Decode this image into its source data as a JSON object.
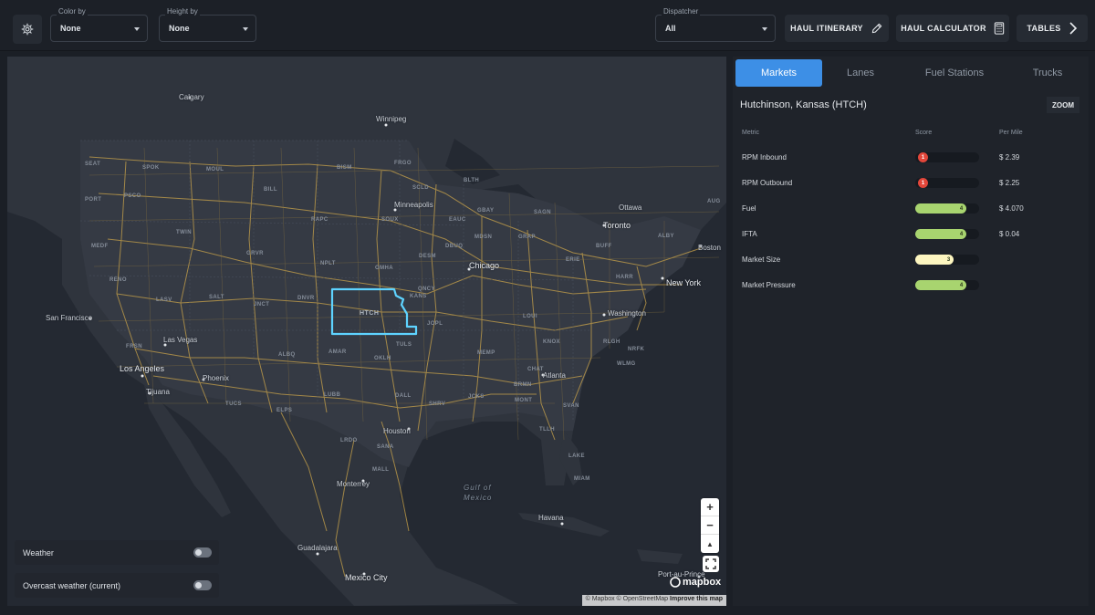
{
  "toolbar": {
    "color_by": {
      "label": "Color by",
      "value": "None"
    },
    "height_by": {
      "label": "Height by",
      "value": "None"
    },
    "dispatcher": {
      "label": "Dispatcher",
      "value": "All"
    },
    "haul_itinerary": "HAUL ITINERARY",
    "haul_calculator": "HAUL CALCULATOR",
    "tables": "TABLES"
  },
  "map": {
    "selected_market": "HTCH",
    "places": [
      {
        "name": "Calgary"
      },
      {
        "name": "Winnipeg"
      },
      {
        "name": "Minneapolis"
      },
      {
        "name": "Ottawa"
      },
      {
        "name": "Toronto"
      },
      {
        "name": "Boston"
      },
      {
        "name": "Chicago"
      },
      {
        "name": "New York"
      },
      {
        "name": "Washington"
      },
      {
        "name": "San Francisco"
      },
      {
        "name": "Las Vegas"
      },
      {
        "name": "Los Angeles"
      },
      {
        "name": "Phoenix"
      },
      {
        "name": "Tijuana"
      },
      {
        "name": "Houston"
      },
      {
        "name": "Atlanta"
      },
      {
        "name": "Monterrey"
      },
      {
        "name": "Havana"
      },
      {
        "name": "Guadalajara"
      },
      {
        "name": "Mexico City"
      },
      {
        "name": "Port-au-Prince"
      }
    ],
    "gulf_label_1": "Gulf of",
    "gulf_label_2": "Mexico",
    "market_codes": [
      "SEAT",
      "SPOK",
      "MOUL",
      "BISM",
      "FRGO",
      "BILL",
      "SCLD",
      "BLTH",
      "PORT",
      "PSCO",
      "RAPC",
      "SOUX",
      "EAUC",
      "GBAY",
      "SAGN",
      "AUG",
      "MEDF",
      "TWIN",
      "GRVR",
      "NPLT",
      "OMHA",
      "DBUQ",
      "DESM",
      "MDSN",
      "GRAP",
      "BUFF",
      "ALBY",
      "RENO",
      "SALT",
      "LASV",
      "JNCT",
      "DNVR",
      "KANS",
      "QNCY",
      "JOPL",
      "ERIE",
      "HARR",
      "NRFK",
      "FRSN",
      "AMAR",
      "OKLH",
      "TULS",
      "DALL",
      "LUBB",
      "SHRV",
      "MONT",
      "JCKS",
      "SVAN",
      "ELPS",
      "LRDO",
      "SANA",
      "MALL",
      "TLLH",
      "LAKE",
      "MIAM",
      "ALBQ",
      "TUCS",
      "MEMP",
      "BRMN",
      "CHAT",
      "KNOX",
      "RLGH",
      "WLMG",
      "LOUI"
    ],
    "zoom_in": "+",
    "zoom_out": "−",
    "compass": "▲",
    "logo_text": "mapbox",
    "attribution_1": "© Mapbox © OpenStreetMap",
    "attribution_2": "Improve this map",
    "weather_label": "Weather",
    "overcast_label": "Overcast weather (current)"
  },
  "panel": {
    "tabs": [
      {
        "label": "Markets",
        "active": true
      },
      {
        "label": "Lanes",
        "active": false
      },
      {
        "label": "Fuel Stations",
        "active": false
      },
      {
        "label": "Trucks",
        "active": false
      }
    ],
    "market_title": "Hutchinson, Kansas (HTCH)",
    "zoom_label": "ZOOM",
    "headers": {
      "metric": "Metric",
      "score": "Score",
      "per_mile": "Per Mile"
    },
    "metrics": [
      {
        "name": "RPM Inbound",
        "score": "1",
        "score_value": 1,
        "per_mile": "$ 2.39",
        "color": "#e2463a"
      },
      {
        "name": "RPM Outbound",
        "score": "1",
        "score_value": 1,
        "per_mile": "$ 2.25",
        "color": "#e2463a"
      },
      {
        "name": "Fuel",
        "score": "4",
        "score_value": 4,
        "per_mile": "$ 4.070",
        "color": "#a8d46f"
      },
      {
        "name": "IFTA",
        "score": "4",
        "score_value": 4,
        "per_mile": "$ 0.04",
        "color": "#a8d46f"
      },
      {
        "name": "Market Size",
        "score": "3",
        "score_value": 3,
        "per_mile": "",
        "color": "#fdf6c0"
      },
      {
        "name": "Market Pressure",
        "score": "4",
        "score_value": 4,
        "per_mile": "",
        "color": "#a8d46f"
      }
    ],
    "score_max": 5
  },
  "colors": {
    "accent": "#3d8fe6",
    "selection_outline": "#5ed3ff",
    "roads": "#c8a24a"
  }
}
